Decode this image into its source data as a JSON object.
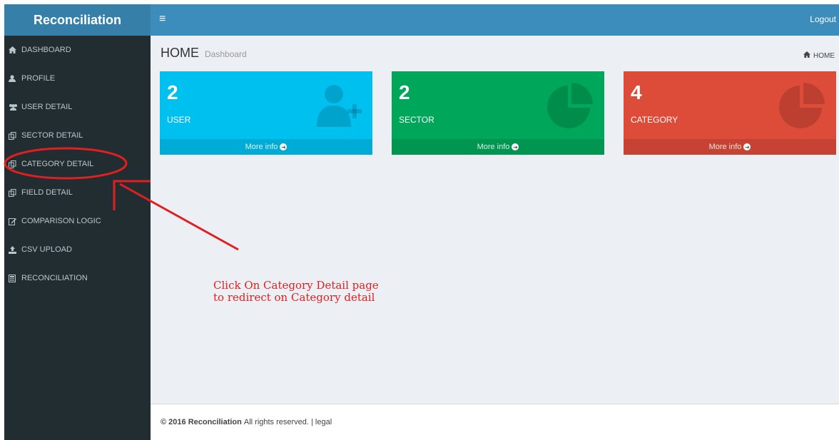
{
  "header": {
    "brand": "Reconciliation",
    "menu_icon": "hamburger-icon",
    "logout_label": "Logout",
    "colors": {
      "brand_bg": "#367fa9",
      "topbar_bg": "#3c8dbc"
    }
  },
  "sidebar": {
    "items": [
      {
        "label": "DASHBOARD",
        "icon": "home-icon"
      },
      {
        "label": "PROFILE",
        "icon": "user-icon"
      },
      {
        "label": "USER DETAIL",
        "icon": "users-icon"
      },
      {
        "label": "SECTOR DETAIL",
        "icon": "copy-icon"
      },
      {
        "label": "CATEGORY DETAIL",
        "icon": "copy-icon"
      },
      {
        "label": "FIELD DETAIL",
        "icon": "copy-icon"
      },
      {
        "label": "COMPARISON LOGIC",
        "icon": "edit-icon"
      },
      {
        "label": "CSV UPLOAD",
        "icon": "upload-icon"
      },
      {
        "label": "RECONCILIATION",
        "icon": "calculator-icon"
      }
    ]
  },
  "main": {
    "title": "HOME",
    "subtitle": "Dashboard",
    "breadcrumb": "HOME",
    "boxes": [
      {
        "count": "2",
        "label": "USER",
        "footer": "More info",
        "icon": "user-plus-icon",
        "color": "#00c0ef"
      },
      {
        "count": "2",
        "label": "SECTOR",
        "footer": "More info",
        "icon": "pie-chart-icon",
        "color": "#00a65a"
      },
      {
        "count": "4",
        "label": "CATEGORY",
        "footer": "More info",
        "icon": "pie-chart-icon",
        "color": "#dd4b39"
      }
    ]
  },
  "footer": {
    "copyright": "© 2016 Reconciliation",
    "rights": "All rights reserved. | legal"
  },
  "annotation": {
    "line1": "Click On Category Detail page",
    "line2": "to redirect on Category detail",
    "color": "#e02020"
  }
}
